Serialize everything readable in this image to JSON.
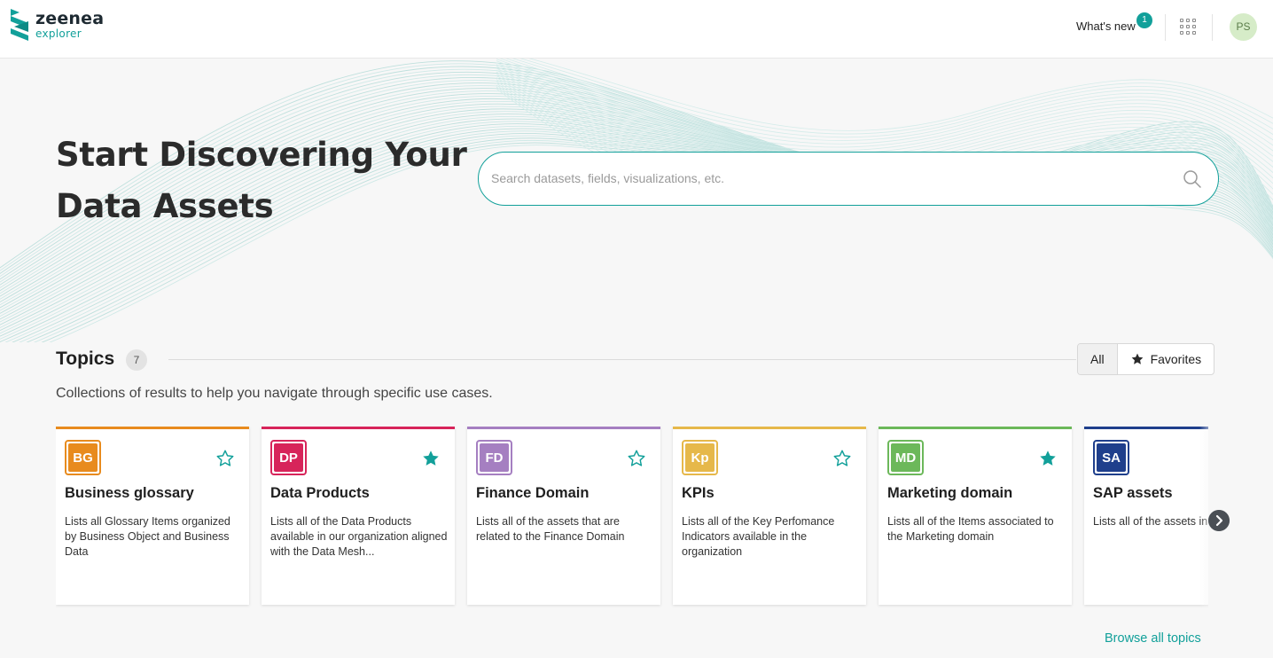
{
  "header": {
    "logo_word": "zeenea",
    "logo_sub": "explorer",
    "whats_new_label": "What's new",
    "whats_new_badge": "1",
    "apps_icon": "grid-apps-icon",
    "avatar_initials": "PS"
  },
  "hero": {
    "title_line1": "Start Discovering Your",
    "title_line2": "Data Assets",
    "search_placeholder": "Search datasets, fields, visualizations, etc.",
    "search_value": ""
  },
  "topics": {
    "title": "Topics",
    "count": "7",
    "filter_all": "All",
    "filter_favorites": "Favorites",
    "description": "Collections of results to help you navigate through specific use cases.",
    "browse_all": "Browse all topics",
    "cards": [
      {
        "code": "BG",
        "title": "Business glossary",
        "desc": "Lists all Glossary Items organized by Business Object and Business Data",
        "color": "#e88b1e",
        "favorite": false
      },
      {
        "code": "DP",
        "title": "Data Products",
        "desc": "Lists all of the Data Products available in our organization aligned with the Data Mesh...",
        "color": "#d7245a",
        "favorite": true
      },
      {
        "code": "FD",
        "title": "Finance Domain",
        "desc": "Lists all of the assets that are related to the Finance Domain",
        "color": "#a57fc1",
        "favorite": false
      },
      {
        "code": "Kp",
        "title": "KPIs",
        "desc": "Lists all of the Key Perfomance Indicators available in the organization",
        "color": "#e6b84a",
        "favorite": false
      },
      {
        "code": "MD",
        "title": "Marketing domain",
        "desc": "Lists all of the Items associated to the Marketing domain",
        "color": "#6cb85a",
        "favorite": true
      },
      {
        "code": "SA",
        "title": "SAP assets",
        "desc": "Lists all of the assets in SAP tables",
        "color": "#1f3f8c",
        "favorite": false
      }
    ]
  },
  "colors": {
    "accent": "#12a09a",
    "text": "#1f1f1f"
  }
}
